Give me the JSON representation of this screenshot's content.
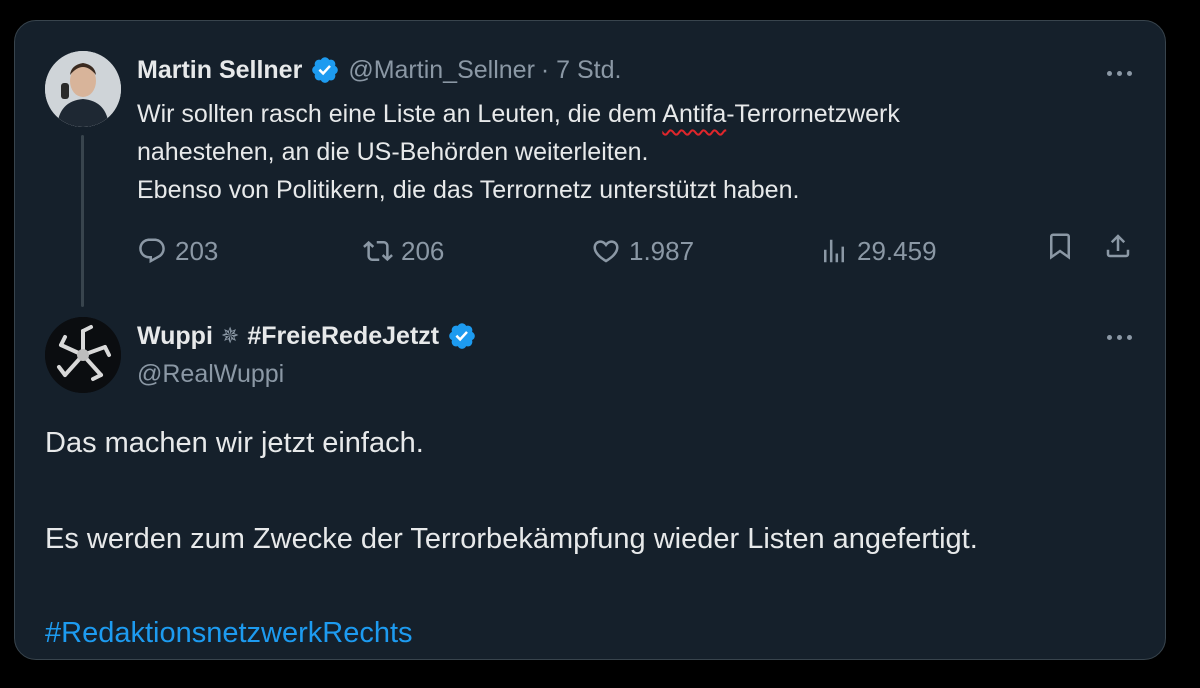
{
  "tweet": {
    "author_name": "Martin Sellner",
    "handle": "@Martin_Sellner",
    "time": "· 7 Std.",
    "text_line1_before": "Wir sollten rasch eine Liste an Leuten, die dem ",
    "text_line1_underlined": "Antifa",
    "text_line1_after": "-Terrornetzwerk",
    "text_line2": "nahestehen, an die US-Behörden weiterleiten.",
    "text_line3": "Ebenso von Politikern, die das Terrornetz unterstützt haben.",
    "replies": "203",
    "retweets": "206",
    "likes": "1.987",
    "views": "29.459"
  },
  "reply": {
    "author_name": "Wuppi",
    "symbol": "✵",
    "author_tag": "#FreieRedeJetzt",
    "handle": "@RealWuppi",
    "text_line1": "Das machen wir jetzt einfach.",
    "text_line2": "Es werden zum Zwecke der Terrorbekämpfung wieder Listen angefertigt.",
    "hashtag": "#RedaktionsnetzwerkRechts"
  },
  "colors": {
    "background": "#15202b",
    "border": "#38444d",
    "text_primary": "#e7e9ea",
    "text_secondary": "#8b98a5",
    "accent_blue": "#1d9bf0",
    "verified_blue": "#1d9bf0",
    "underline_red": "#e0262b"
  },
  "icons": [
    "verified-badge-icon",
    "more-options-icon",
    "reply-icon",
    "retweet-icon",
    "like-icon",
    "views-icon",
    "bookmark-icon",
    "share-icon"
  ]
}
